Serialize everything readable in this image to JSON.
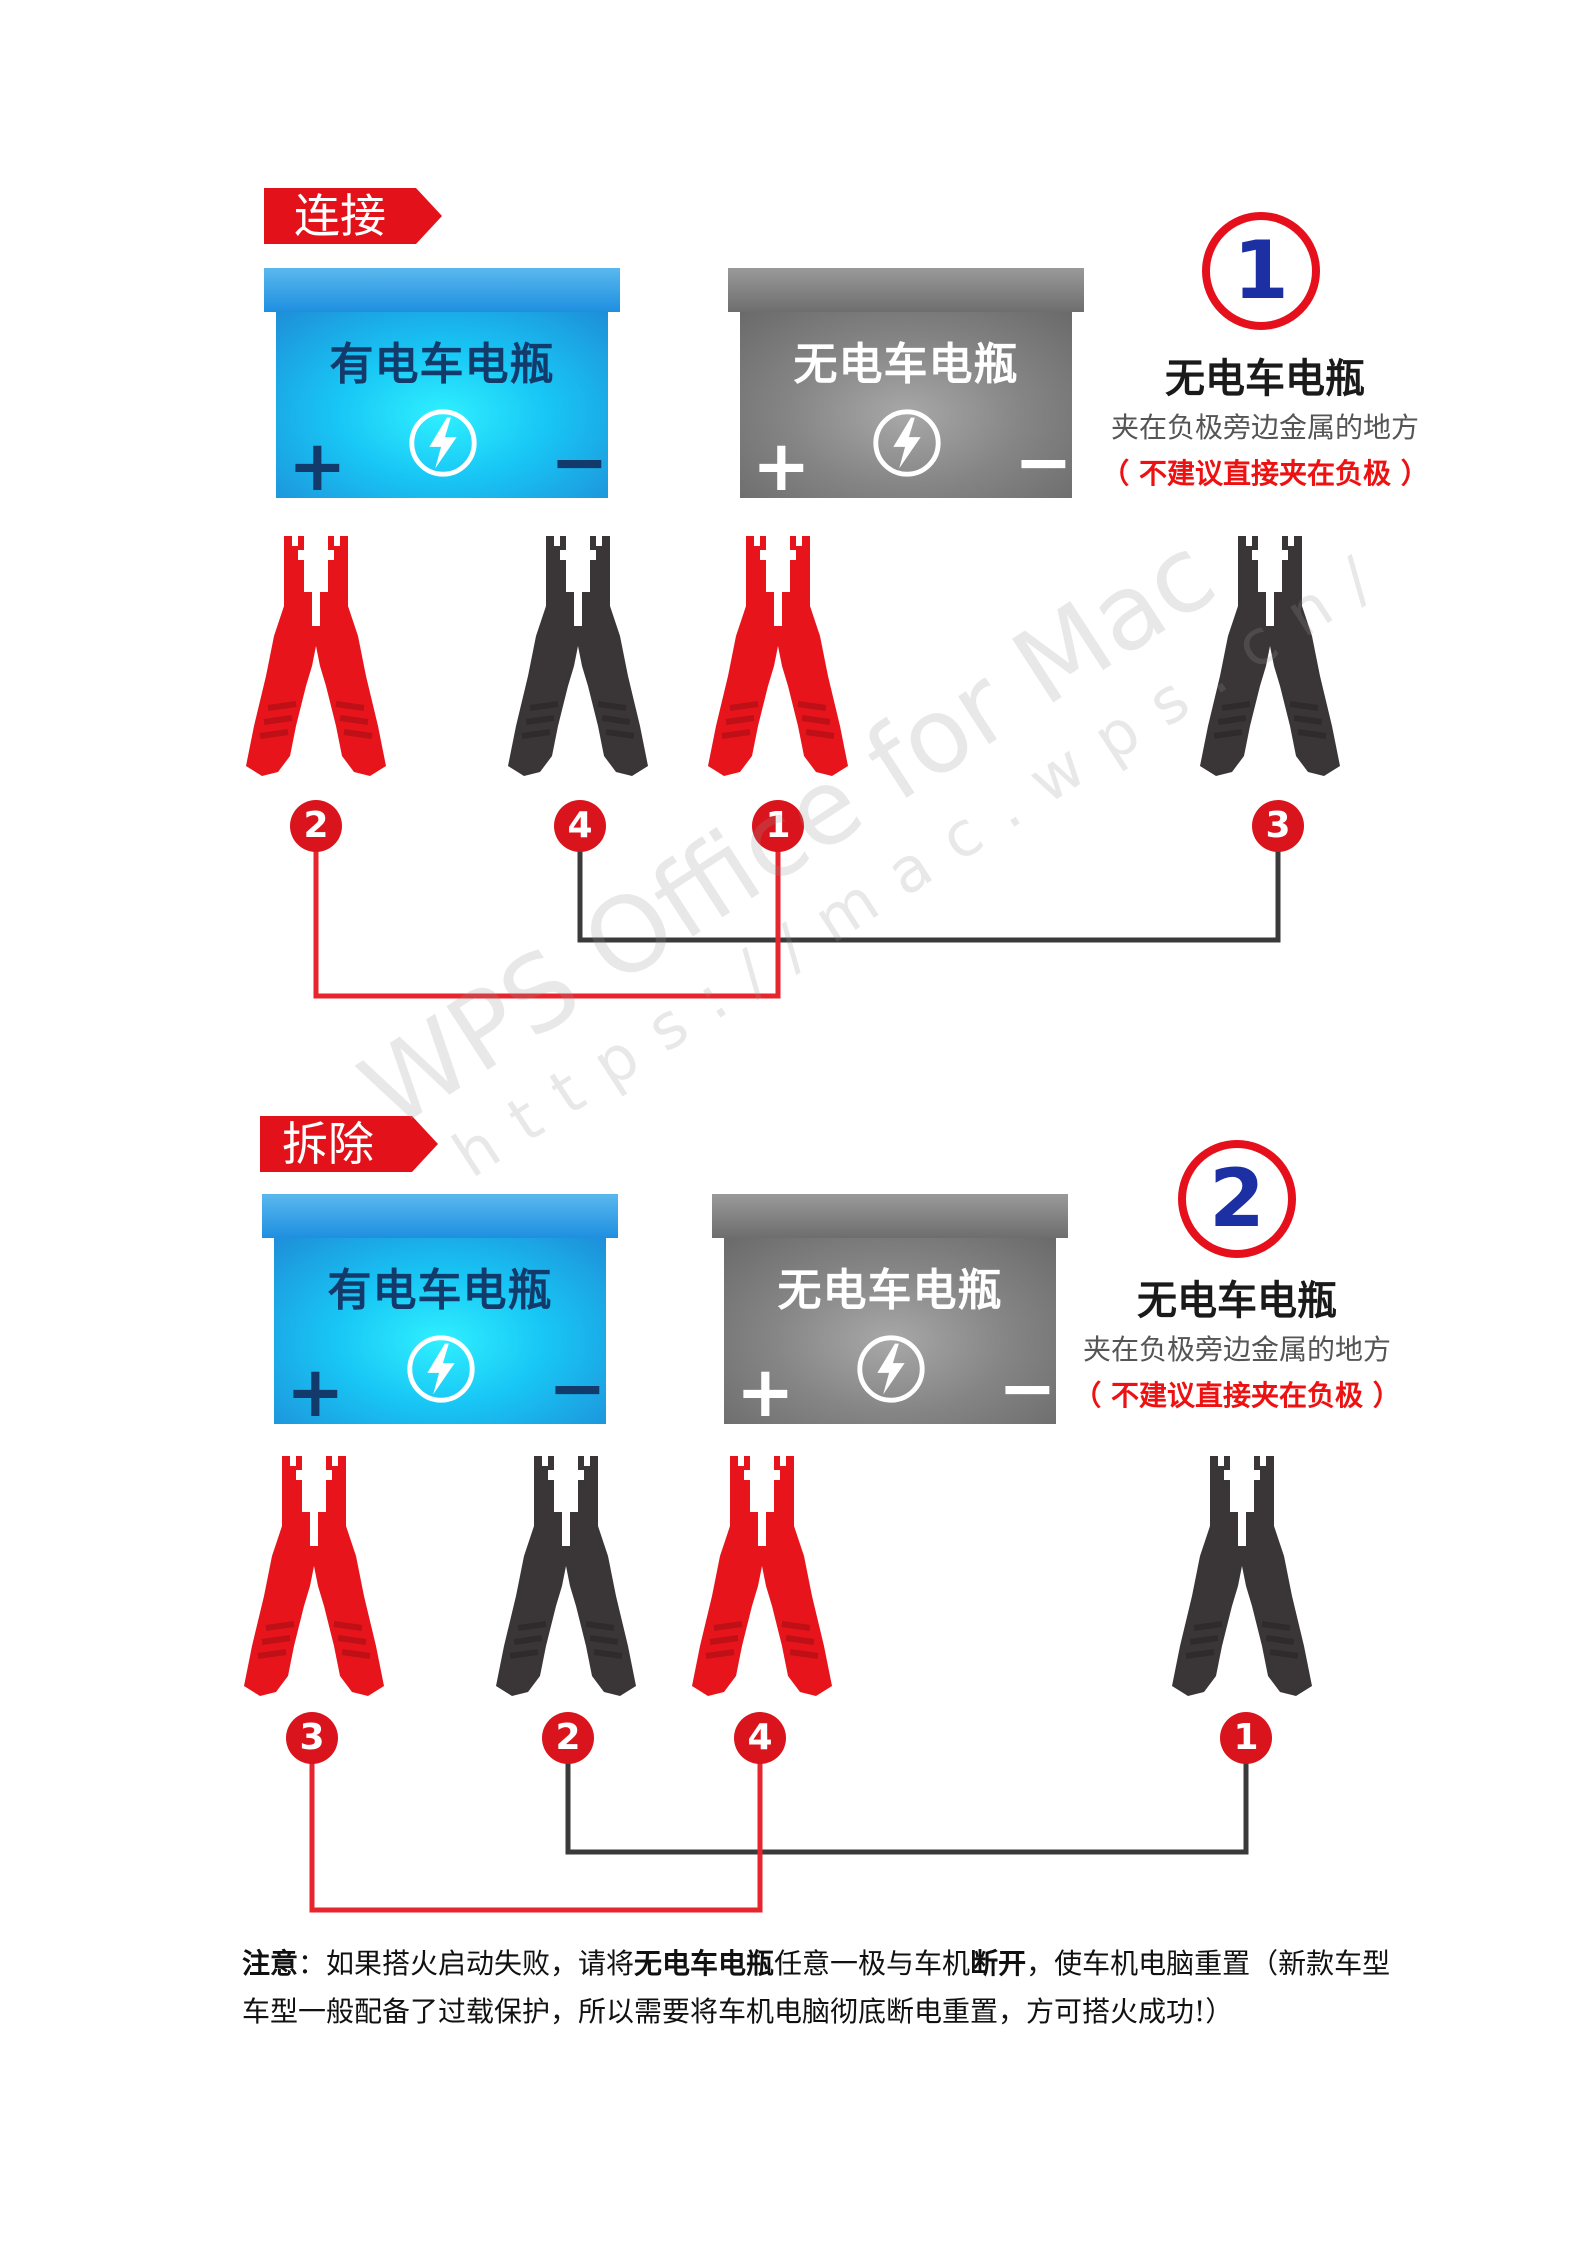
{
  "sections": [
    {
      "tag": "连接",
      "step_number": "1",
      "batteries": {
        "live": {
          "title": "有电车电瓶",
          "plus": "+",
          "minus": "−"
        },
        "dead": {
          "title": "无电车电瓶",
          "plus": "+",
          "minus": "−"
        }
      },
      "info": {
        "title": "无电车电瓶",
        "subtitle": "夹在负极旁边金属的地方",
        "warning": "（ 不建议直接夹在负极 ）"
      },
      "clamp_badges": [
        "2",
        "4",
        "1",
        "3"
      ]
    },
    {
      "tag": "拆除",
      "step_number": "2",
      "batteries": {
        "live": {
          "title": "有电车电瓶",
          "plus": "+",
          "minus": "−"
        },
        "dead": {
          "title": "无电车电瓶",
          "plus": "+",
          "minus": "−"
        }
      },
      "info": {
        "title": "无电车电瓶",
        "subtitle": "夹在负极旁边金属的地方",
        "warning": "（ 不建议直接夹在负极 ）"
      },
      "clamp_badges": [
        "3",
        "2",
        "4",
        "1"
      ]
    }
  ],
  "colors": {
    "tag_red": "#e3121a",
    "live_battery_blue": "#22b8f0",
    "dead_battery_gray": "#7d7d7d",
    "clamp_red": "#e8141c",
    "clamp_black": "#3a3536",
    "wire_red": "#e6262c",
    "wire_black": "#3a3a3a"
  },
  "note": {
    "label": "注意",
    "part1": "：如果搭火启动失败，请将",
    "bold1": "无电车电瓶",
    "part2": "任意一极与车机",
    "bold2": "断开",
    "part3": "，使车机电脑重置（新款车型车型一般配备了过载保护，所以需要将车机电脑彻底断电重置，方可搭火成功!）"
  },
  "watermark": {
    "line1": "WPS Office for Mac",
    "line2": "https://mac.wps.cn/"
  }
}
